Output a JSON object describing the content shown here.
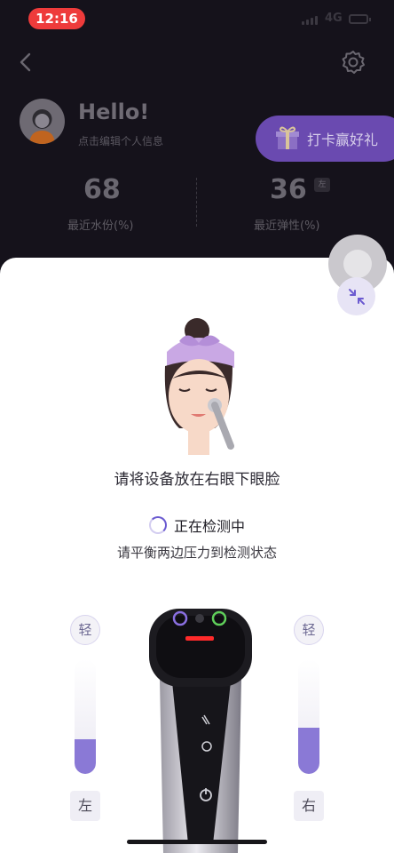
{
  "status_bar": {
    "time": "12:16",
    "network": "4G"
  },
  "profile": {
    "greeting": "Hello!",
    "edit_hint": "点击编辑个人信息"
  },
  "checkin_label": "打卡赢好礼",
  "stats": [
    {
      "value": "68",
      "label": "最近水份(%)"
    },
    {
      "value": "36",
      "label": "最近弹性(%)",
      "tag": "左"
    }
  ],
  "measure": {
    "instruction": "请将设备放在右眼下眼脸",
    "status": "正在检测中",
    "hint": "请平衡两边压力到检测状态"
  },
  "pressure": {
    "left": {
      "level_label": "轻",
      "side_label": "左",
      "fill_fraction": 0.3
    },
    "right": {
      "level_label": "轻",
      "side_label": "右",
      "fill_fraction": 0.4
    }
  },
  "colors": {
    "accent": "#8a79d6",
    "checkin_bg": "#6a4ab0",
    "time_pill": "#ee3b3b"
  }
}
